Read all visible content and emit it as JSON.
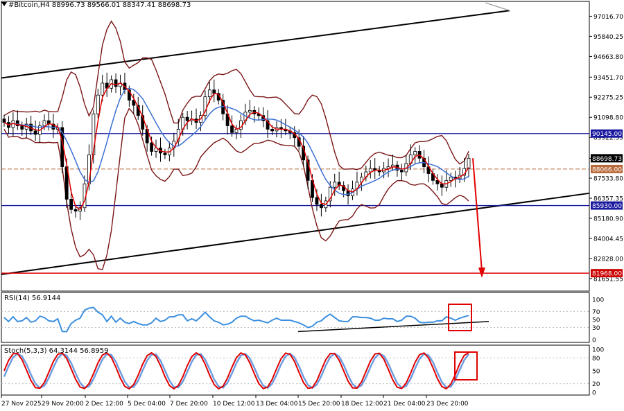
{
  "header": {
    "title": "#Bitcoin,H4  88996.73 89566.01 88347.41 88698.73",
    "rsi_label": "RSI(14) 56.9144",
    "stoch_label": "Stoch(5,3,3) 64.3144 56.8959"
  },
  "colors": {
    "price": "#7a1515",
    "ma_fast": "#e00000",
    "ma_slow": "#3b6fd4",
    "support_line": "#1a1aa0",
    "target_line": "#e00000",
    "channel": "#000000",
    "rsi": "#3b8fe0",
    "stoch_main": "#e00000",
    "stoch_signal": "#6a9ae0",
    "tag_blue": "#1a1aa0",
    "tag_red": "#cc0000",
    "tag_current": "#000000",
    "tag_dashed": "#b86a3a"
  },
  "chart_data": [
    {
      "type": "candlestick",
      "title": "#Bitcoin,H4",
      "ylim": [
        81000,
        97400
      ],
      "y_ticks": [
        "97016.70",
        "95840.25",
        "94663.80",
        "93451.70",
        "92275.25",
        "91098.80",
        "89922.35",
        "88698.73",
        "87533.80",
        "86357.35",
        "85180.90",
        "84004.45",
        "82828.00",
        "81651.55"
      ],
      "x_ticks": [
        "27 Nov 2025",
        "29 Nov 20:00",
        "2 Dec 12:00",
        "5 Dec 04:00",
        "7 Dec 20:00",
        "10 Dec 12:00",
        "13 Dec 04:00",
        "15 Dec 20:00",
        "18 Dec 12:00",
        "21 Dec 04:00",
        "23 Dec 20:00"
      ],
      "levels": [
        {
          "value": 90145,
          "label": "90145.00",
          "style": "solid-blue"
        },
        {
          "value": 88698.73,
          "label": "88698.73",
          "style": "current"
        },
        {
          "value": 88066,
          "label": "88066.00",
          "style": "dashed-brown"
        },
        {
          "value": 85930,
          "label": "85930.00",
          "style": "solid-blue"
        },
        {
          "value": 81968,
          "label": "81968.00",
          "style": "solid-red"
        }
      ],
      "close": [
        90800,
        90500,
        90900,
        90600,
        90400,
        90700,
        90300,
        90100,
        90600,
        90900,
        90700,
        90400,
        90500,
        88200,
        86300,
        85700,
        85600,
        85800,
        87200,
        88900,
        91300,
        92400,
        93100,
        92800,
        93300,
        92900,
        93100,
        92700,
        92100,
        91800,
        91200,
        90400,
        89600,
        89100,
        89300,
        89000,
        88900,
        89300,
        89700,
        90400,
        91100,
        90900,
        91000,
        90800,
        91200,
        92300,
        92700,
        92500,
        92100,
        91300,
        90600,
        90200,
        90400,
        90900,
        91400,
        91500,
        91300,
        91200,
        90900,
        90400,
        90300,
        90500,
        90400,
        90300,
        90200,
        89900,
        89400,
        88600,
        87400,
        86400,
        86000,
        85800,
        86200,
        87000,
        87300,
        87100,
        86800,
        86500,
        86900,
        87300,
        87600,
        87900,
        88100,
        88000,
        87900,
        88100,
        88200,
        88300,
        88000,
        87900,
        88400,
        88900,
        89100,
        88700,
        88200,
        87800,
        87400,
        87200,
        87000,
        87400,
        87600,
        87500,
        87700,
        88100,
        88700
      ],
      "series": [
        {
          "name": "RSI(14)",
          "ylim": [
            0,
            100
          ],
          "y_ticks": [
            0,
            30,
            50,
            70,
            100
          ],
          "current": 56.9144
        },
        {
          "name": "Stoch(5,3,3)",
          "ylim": [
            0,
            100
          ],
          "y_ticks": [
            0,
            20,
            50,
            80,
            100
          ],
          "main": 64.3144,
          "signal": 56.8959
        }
      ]
    }
  ]
}
